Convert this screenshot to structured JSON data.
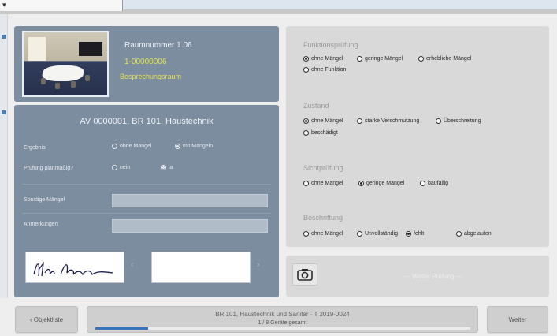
{
  "topbar": {
    "arrow": "▾"
  },
  "room": {
    "name": "Raumnummer 1.06",
    "id": "1-00000006",
    "type": "Besprechungsraum"
  },
  "form": {
    "title": "AV 0000001, BR 101, Haustechnik",
    "ergebnis_label": "Ergebnis",
    "ergebnis_options": [
      {
        "label": "ohne Mängel",
        "selected": false
      },
      {
        "label": "mit Mängeln",
        "selected": true
      }
    ],
    "pruefung_label": "Prüfung planmäßig?",
    "pruefung_options": [
      {
        "label": "nein",
        "selected": false
      },
      {
        "label": "ja",
        "selected": true
      }
    ],
    "sonstige_label": "Sonstige Mängel",
    "anmerkungen_label": "Anmerkungen",
    "signature_text": "Max Mustermann",
    "arrow_left": "‹",
    "arrow_right": "›"
  },
  "sections": [
    {
      "title": "Funktionsprüfung",
      "options": [
        {
          "label": "ohne Mängel",
          "selected": true
        },
        {
          "label": "geringe Mängel",
          "selected": false
        },
        {
          "label": "erhebliche Mängel",
          "selected": false
        },
        {
          "label": "ohne Funktion",
          "selected": false
        }
      ]
    },
    {
      "title": "Zustand",
      "options": [
        {
          "label": "ohne Mängel",
          "selected": true
        },
        {
          "label": "starke Verschmutzung",
          "selected": false
        },
        {
          "label": "Überschreitung",
          "selected": false
        },
        {
          "label": "beschädigt",
          "selected": false
        }
      ]
    },
    {
      "title": "Sichtprüfung",
      "options": [
        {
          "label": "ohne Mängel",
          "selected": false
        },
        {
          "label": "geringe Mängel",
          "selected": true
        },
        {
          "label": "baufällig",
          "selected": false
        }
      ]
    },
    {
      "title": "Beschriftung",
      "options": [
        {
          "label": "ohne Mängel",
          "selected": false
        },
        {
          "label": "Unvollständig",
          "selected": false
        },
        {
          "label": "fehlt",
          "selected": true
        },
        {
          "label": "abgelaufen",
          "selected": false
        }
      ]
    }
  ],
  "action_panel": {
    "next_label": "— Weiter Prüfung —"
  },
  "bottom": {
    "left_button": "‹ Objektliste",
    "center_title": "BR 101, Haustechnik und Sanitär · T 2019-0024",
    "center_sub": "1 / 8 Geräte gesamt",
    "progress": 0.14,
    "right_button": "Weiter"
  },
  "colors": {
    "panel_dark": "#7d8da0",
    "panel_light": "#d9d9d9",
    "accent_yellow": "#e3e05a",
    "progress": "#3773b8"
  }
}
